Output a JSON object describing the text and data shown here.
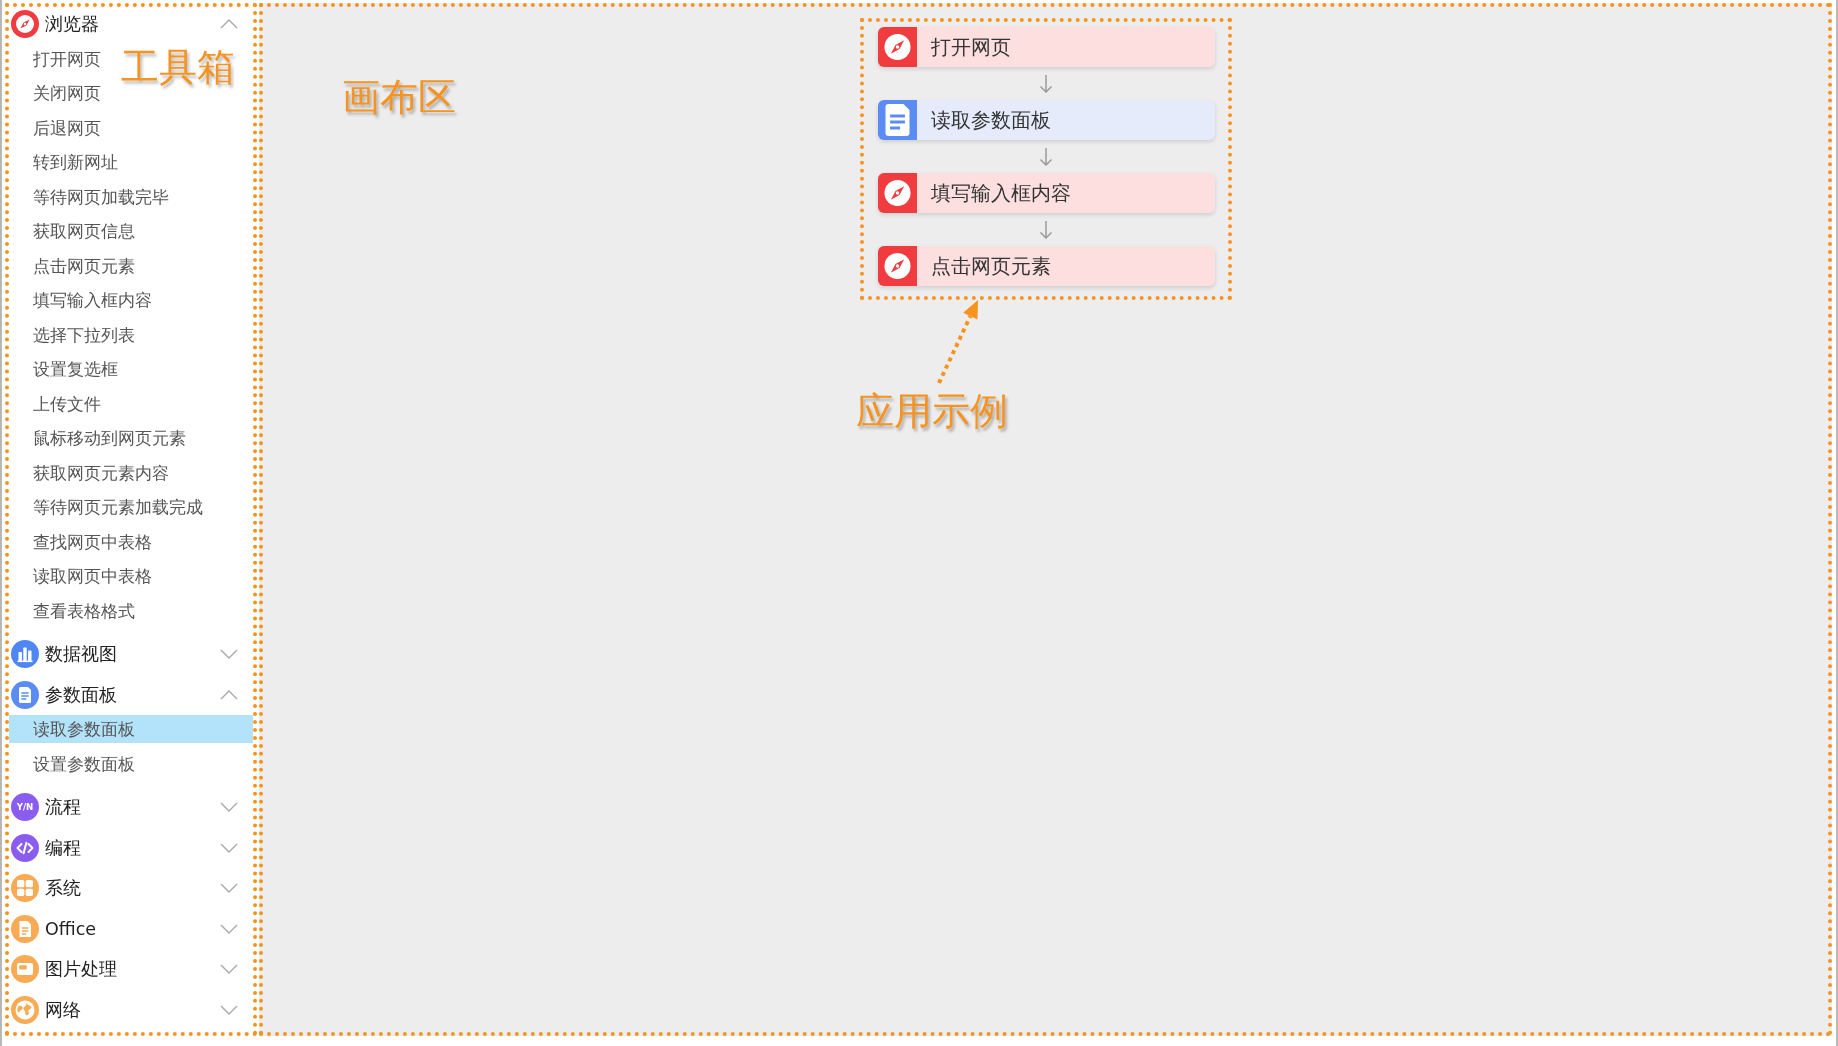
{
  "sidebar": {
    "annotation": "工具箱",
    "groups": [
      {
        "kind": "browser",
        "label": "浏览器",
        "expanded": true,
        "items": [
          {
            "label": "打开网页",
            "selected": false
          },
          {
            "label": "关闭网页",
            "selected": false
          },
          {
            "label": "后退网页",
            "selected": false
          },
          {
            "label": "转到新网址",
            "selected": false
          },
          {
            "label": "等待网页加载完毕",
            "selected": false
          },
          {
            "label": "获取网页信息",
            "selected": false
          },
          {
            "label": "点击网页元素",
            "selected": false
          },
          {
            "label": "填写输入框内容",
            "selected": false
          },
          {
            "label": "选择下拉列表",
            "selected": false
          },
          {
            "label": "设置复选框",
            "selected": false
          },
          {
            "label": "上传文件",
            "selected": false
          },
          {
            "label": "鼠标移动到网页元素",
            "selected": false
          },
          {
            "label": "获取网页元素内容",
            "selected": false
          },
          {
            "label": "等待网页元素加载完成",
            "selected": false
          },
          {
            "label": "查找网页中表格",
            "selected": false
          },
          {
            "label": "读取网页中表格",
            "selected": false
          },
          {
            "label": "查看表格格式",
            "selected": false
          }
        ]
      },
      {
        "kind": "chart",
        "label": "数据视图",
        "expanded": false
      },
      {
        "kind": "panel",
        "label": "参数面板",
        "expanded": true,
        "items": [
          {
            "label": "读取参数面板",
            "selected": true
          },
          {
            "label": "设置参数面板",
            "selected": false
          }
        ]
      },
      {
        "kind": "flow",
        "label": "流程",
        "expanded": false,
        "icon_text": "Y/N"
      },
      {
        "kind": "code",
        "label": "编程",
        "expanded": false
      },
      {
        "kind": "system",
        "label": "系统",
        "expanded": false
      },
      {
        "kind": "office",
        "label": "Office",
        "expanded": false
      },
      {
        "kind": "image",
        "label": "图片处理",
        "expanded": false
      },
      {
        "kind": "network",
        "label": "网络",
        "expanded": false
      }
    ]
  },
  "canvas": {
    "annotation": "画布区",
    "example": {
      "annotation": "应用示例",
      "nodes": [
        {
          "kind": "browser",
          "label": "打开网页"
        },
        {
          "kind": "panel",
          "label": "读取参数面板"
        },
        {
          "kind": "browser",
          "label": "填写输入框内容"
        },
        {
          "kind": "browser",
          "label": "点击网页元素"
        }
      ]
    }
  }
}
